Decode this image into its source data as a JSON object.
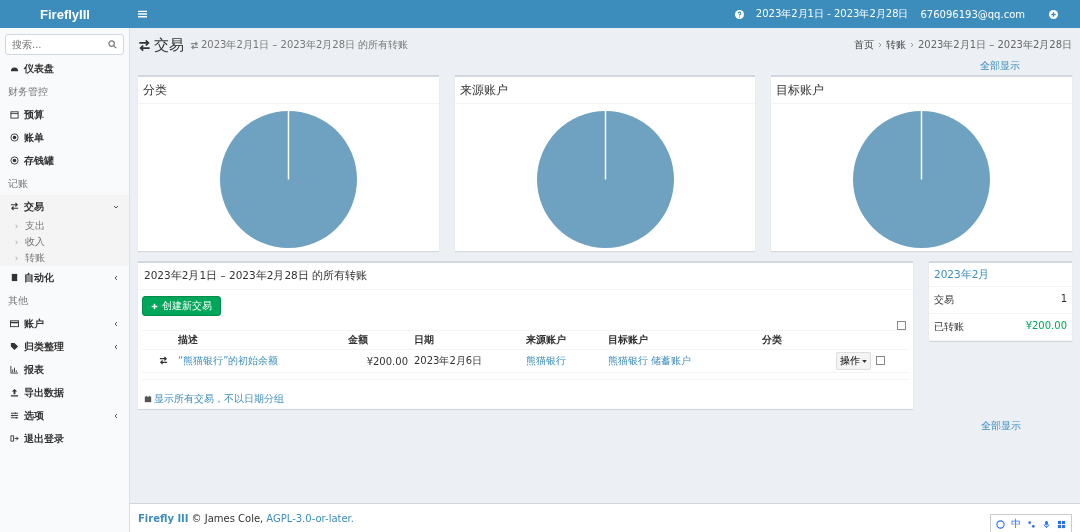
{
  "header": {
    "brand": "FireflyIII",
    "date_range": "2023年2月1日 - 2023年2月28日",
    "user_email": "676096193@qq.com"
  },
  "sidebar": {
    "search": {
      "placeholder": "搜索..."
    },
    "items": [
      {
        "kind": "link",
        "label": "仪表盘"
      },
      {
        "kind": "header",
        "label": "财务管控"
      },
      {
        "kind": "link",
        "label": "预算"
      },
      {
        "kind": "link",
        "label": "账单"
      },
      {
        "kind": "link",
        "label": "存钱罐"
      },
      {
        "kind": "header",
        "label": "记账"
      },
      {
        "kind": "menu",
        "label": "交易",
        "expanded": true,
        "children": [
          {
            "label": "支出"
          },
          {
            "label": "收入"
          },
          {
            "label": "转账"
          }
        ]
      },
      {
        "kind": "menu",
        "label": "自动化",
        "expanded": false
      },
      {
        "kind": "header",
        "label": "其他"
      },
      {
        "kind": "menu",
        "label": "账户",
        "expanded": false
      },
      {
        "kind": "menu",
        "label": "归类整理",
        "expanded": false
      },
      {
        "kind": "link",
        "label": "报表"
      },
      {
        "kind": "link",
        "label": "导出数据"
      },
      {
        "kind": "menu",
        "label": "选项",
        "expanded": false
      },
      {
        "kind": "link",
        "label": "退出登录"
      }
    ]
  },
  "page": {
    "title": "交易",
    "subtitle": "2023年2月1日 – 2023年2月28日 的所有转账",
    "breadcrumbs": [
      {
        "label": "首页",
        "kind": "link"
      },
      {
        "label": "转账",
        "kind": "link"
      },
      {
        "label": "2023年2月1日 – 2023年2月28日",
        "kind": "current"
      }
    ],
    "show_all": "全部显示"
  },
  "charts": [
    {
      "title": "分类"
    },
    {
      "title": "来源账户"
    },
    {
      "title": "目标账户"
    }
  ],
  "transactions": {
    "title": "2023年2月1日 – 2023年2月28日 的所有转账",
    "create_button": "创建新交易",
    "select_all_checked": false,
    "columns": [
      "描述",
      "金额",
      "日期",
      "来源账户",
      "目标账户",
      "分类"
    ],
    "rows": [
      {
        "description": "“熊猫银行”的初始余额",
        "amount": "¥200.00",
        "date": "2023年2月6日",
        "source": "熊猫银行",
        "destination": "熊猫银行 储蓄账户",
        "action": "操作",
        "checked": false
      }
    ],
    "footer_link": "显示所有交易，不以日期分组"
  },
  "summary": {
    "title": "2023年2月",
    "rows": [
      {
        "label": "交易",
        "value": "1",
        "kind": "plain"
      },
      {
        "label": "已转账",
        "value": "¥200.00",
        "kind": "money"
      }
    ],
    "show_all": "全部显示"
  },
  "footer": {
    "brand": "Firefly III",
    "text": "© James Cole,",
    "link": "AGPL-3.0-or-later."
  },
  "ime_bar": {
    "mode": "中"
  }
}
